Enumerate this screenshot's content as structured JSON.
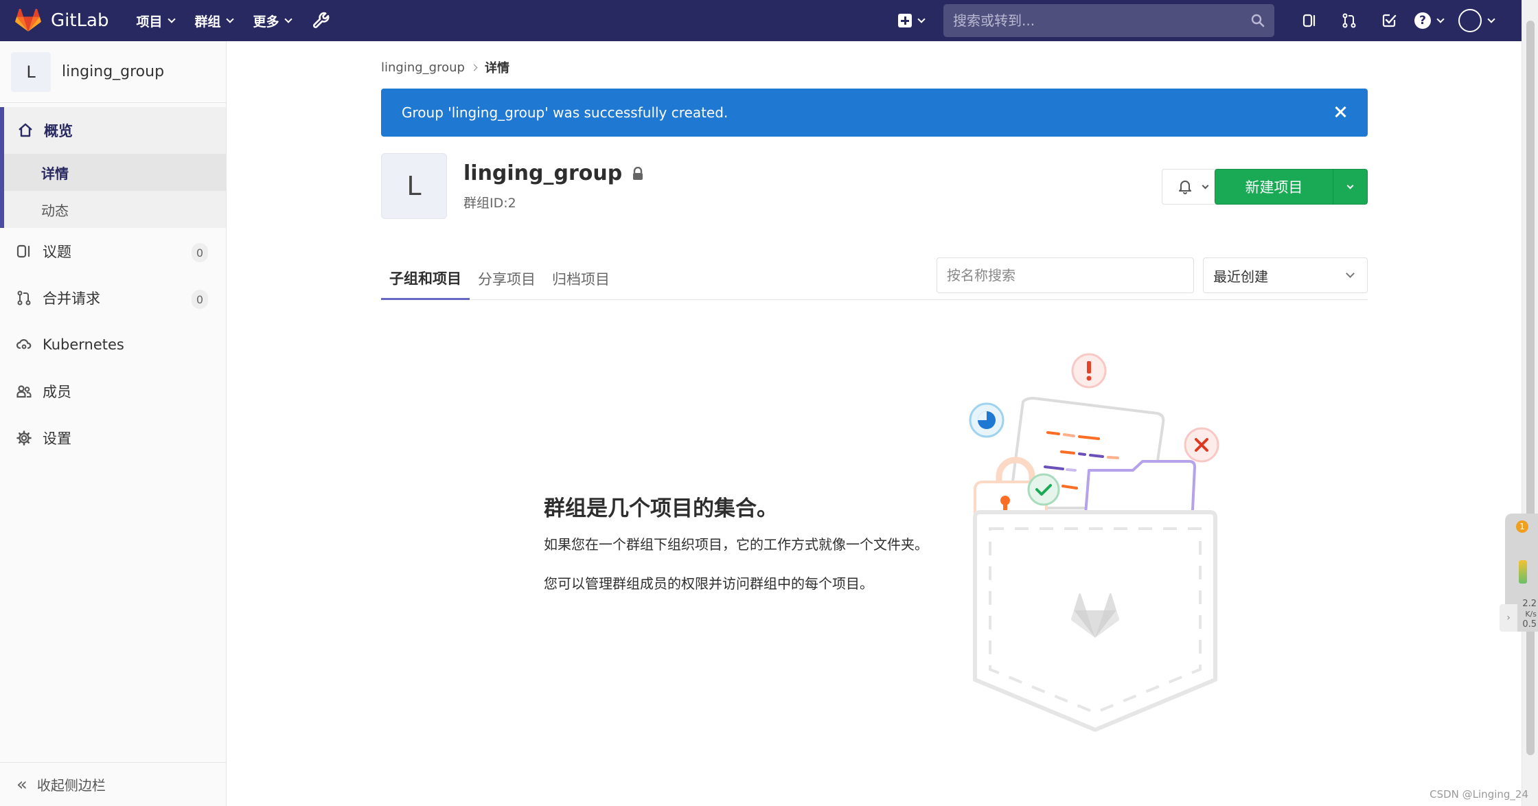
{
  "navbar": {
    "brand": "GitLab",
    "menus": [
      "项目",
      "群组",
      "更多"
    ],
    "search_placeholder": "搜索或转到..."
  },
  "sidebar": {
    "context_avatar": "L",
    "context_name": "linging_group",
    "overview_label": "概览",
    "overview_sub": [
      "详情",
      "动态"
    ],
    "issues_label": "议题",
    "issues_count": "0",
    "mr_label": "合并请求",
    "mr_count": "0",
    "kubernetes_label": "Kubernetes",
    "members_label": "成员",
    "settings_label": "设置",
    "collapse_label": "收起侧边栏"
  },
  "breadcrumb": {
    "parent": "linging_group",
    "current": "详情"
  },
  "flash": {
    "message": "Group 'linging_group' was successfully created."
  },
  "group": {
    "avatar": "L",
    "name": "linging_group",
    "id_text": "群组ID:2",
    "new_project_label": "新建项目"
  },
  "tabs": [
    "子组和项目",
    "分享项目",
    "归档项目"
  ],
  "filter": {
    "search_placeholder": "按名称搜索",
    "sort_selected": "最近创建"
  },
  "empty_state": {
    "title": "群组是几个项目的集合。",
    "line1": "如果您在一个群组下组织项目，它的工作方式就像一个文件夹。",
    "line2": "您可以管理群组成员的权限并访问群组中的每个项目。"
  },
  "net_widget": {
    "badge": "1",
    "up_value": "2.2",
    "up_unit": "K/s",
    "down_value": "0.5",
    "down_unit": "K/s"
  },
  "watermark": "CSDN @Linging_24",
  "colors": {
    "navbar": "#292961",
    "flash": "#1f78d1",
    "primary_button": "#1aaa55",
    "active_tab": "#6666c4"
  }
}
